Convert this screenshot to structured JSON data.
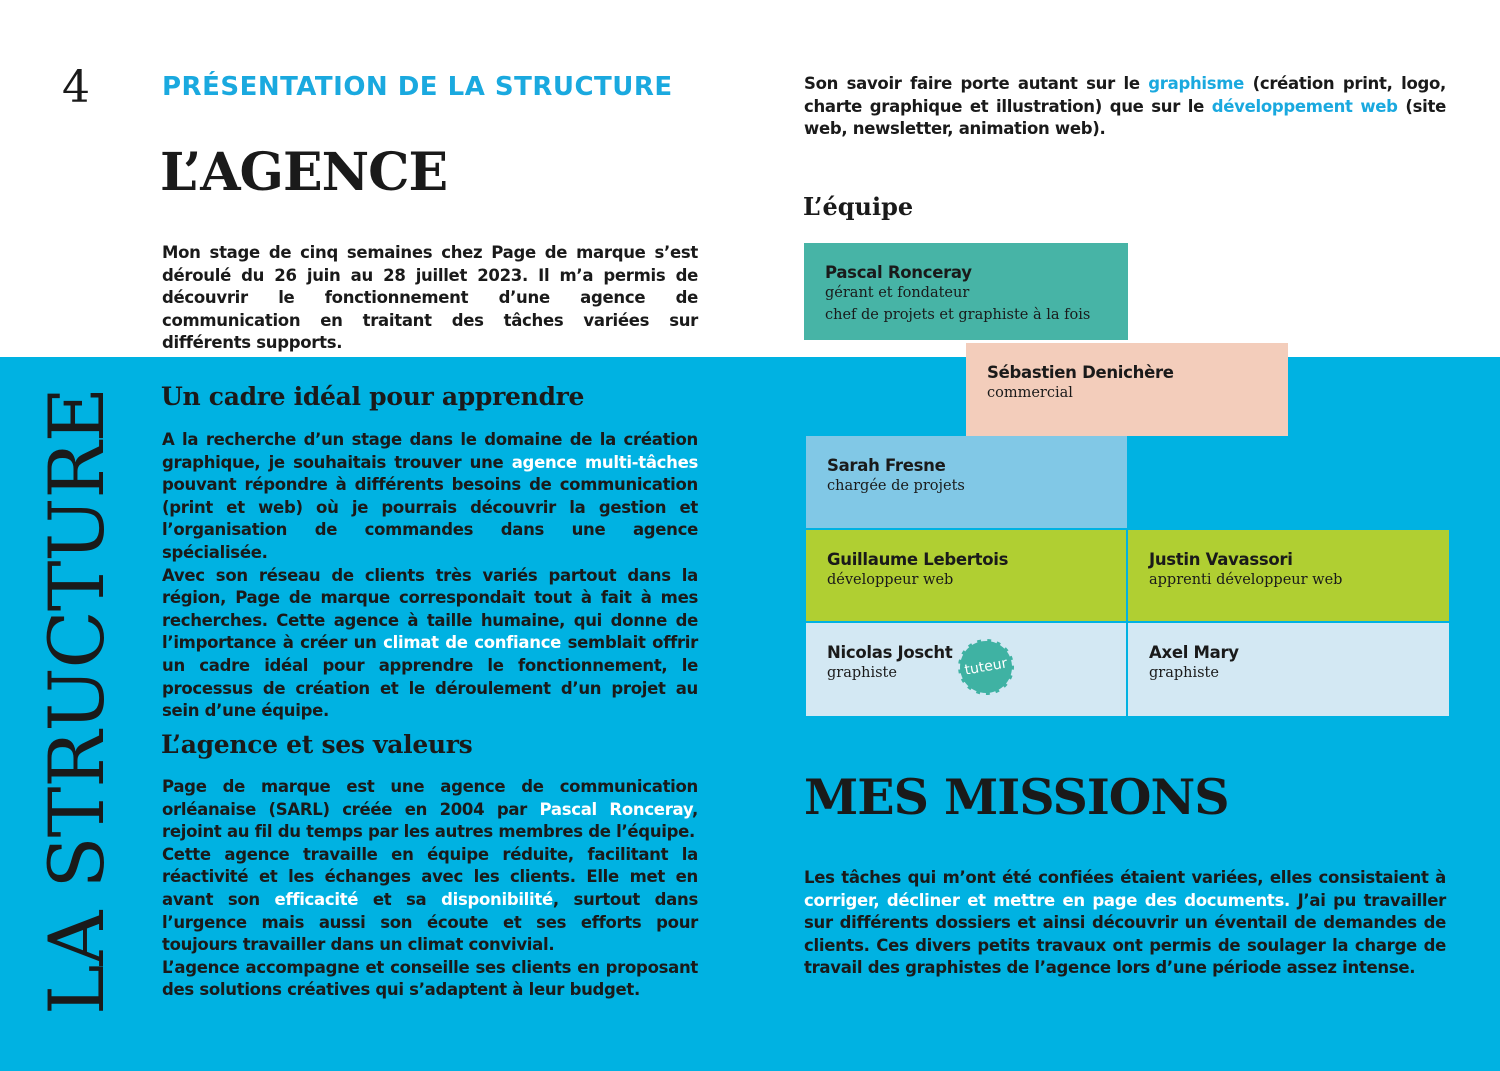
{
  "page_number": "4",
  "section_label": "PRÉSENTATION DE LA STRUCTURE",
  "heading_agence": "L’AGENCE",
  "intro": "Mon stage de cinq semaines chez Page de marque s’est déroulé du 26 juin au 28 juillet 2023. Il m’a permis de découvrir le fonc­tionnement d’une agence de communication en traitant des tâches variées sur différents supports.",
  "side_title": "LA STRUCTURE",
  "cadre": {
    "title": "Un cadre idéal pour apprendre",
    "t1": "A la recherche d’un stage dans le domaine de la création graphique, je souhaitais trouver une ",
    "h1": "agence multi-tâches",
    "t2": " pouvant répondre à différents besoins de communication (print et web) où je pourrais découvrir la gestion et l’organisation de commandes dans une agence spécialisée.",
    "t3": "Avec son réseau de clients très variés partout dans la région, Page de marque correspondait tout à fait à mes recherches. Cette agence à taille humaine, qui donne de l’importance à créer un ",
    "h2": "climat de confiance",
    "t4": " semblait offrir un cadre idéal pour apprendre le fonctionnement, le processus de création et le déroulement d’un projet au sein d’une équipe."
  },
  "valeurs": {
    "title": "L’agence et ses valeurs",
    "t1": "Page de marque est une agence de communication orléanaise (SARL) créée en 2004 par ",
    "h1": "Pascal Ronceray",
    "t2": ", rejoint au fil du temps par les autres membres de l’équipe.",
    "t3": "Cette agence travaille en équipe réduite, facilitant la réactivité et les échanges avec les clients. Elle met en avant son ",
    "h2": "efficacité",
    "t4": " et sa ",
    "h3": "disponibilité",
    "t5": ", surtout dans l’urgence mais aussi son écoute et ses efforts pour toujours travailler dans un climat convivial.",
    "t6": "L’agence accompagne et conseille ses clients en proposant des solutions créatives qui s’adaptent à leur budget."
  },
  "savoir": {
    "t1": "Son savoir faire porte autant sur le ",
    "h1": "graphisme",
    "t2": " (création print, logo, charte graphique et illustration) que sur le ",
    "h2": "développement web",
    "t3": " (site web, newsletter, animation web)."
  },
  "equipe": {
    "title": "L’équipe",
    "members": [
      {
        "name": "Pascal Ronceray",
        "role1": "gérant et fondateur",
        "role2": "chef de projets et graphiste à la fois"
      },
      {
        "name": "Sébastien Denichère",
        "role1": "commercial"
      },
      {
        "name": "Sarah Fresne",
        "role1": "chargée de projets"
      },
      {
        "name": "Guillaume Lebertois",
        "role1": "développeur web"
      },
      {
        "name": "Justin Vavassori",
        "role1": "apprenti développeur web"
      },
      {
        "name": "Nicolas Joscht",
        "role1": "graphiste"
      },
      {
        "name": "Axel Mary",
        "role1": "graphiste"
      }
    ],
    "badge": "tuteur"
  },
  "missions": {
    "title": "MES MISSIONS",
    "t1": "Les tâches qui m’ont été confiées étaient variées, elles consistaient à ",
    "h1": "corriger, décliner et mettre en page des documents.",
    "t2": " J’ai pu travailler sur différents dossiers et ainsi découvrir un éventail de demandes de clients. Ces divers petits travaux ont permis de soulager la charge de travail des graphistes de l’agence lors d’une période assez intense."
  },
  "colors": {
    "accent_blue": "#00b2e2",
    "title_blue": "#1aa9df",
    "teal": "#47b4a6",
    "peach": "#f3cdbb",
    "light_blue": "#81c8e6",
    "lime": "#b0cf32",
    "pale_blue": "#d3e8f3"
  }
}
